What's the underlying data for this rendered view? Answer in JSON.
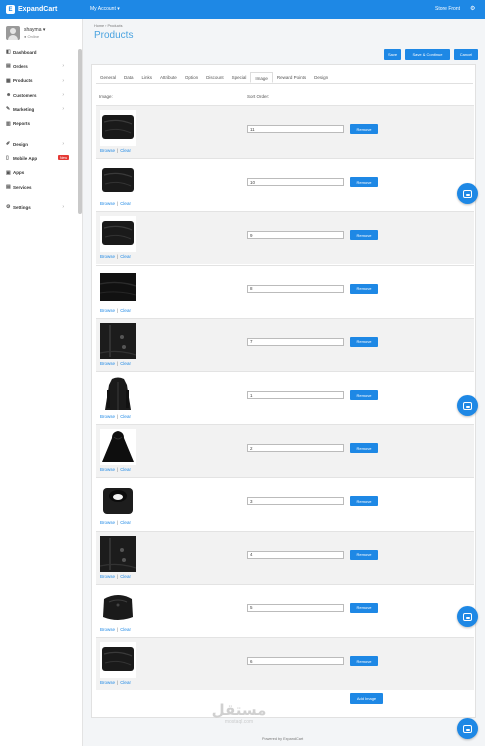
{
  "topbar": {
    "logo_text": "ExpandCart",
    "my_account": "My Account",
    "store_front": "Store Front",
    "settings_glyph": "⚙"
  },
  "user": {
    "name": "shayma",
    "status": "● Online"
  },
  "sidebar": {
    "items": [
      {
        "label": "Dashboard",
        "icon": "dashboard-icon",
        "glyph": "◧",
        "chevron": ""
      },
      {
        "label": "Orders",
        "icon": "orders-icon",
        "glyph": "▤",
        "chevron": "›"
      },
      {
        "label": "Products",
        "icon": "products-icon",
        "glyph": "▦",
        "chevron": "›"
      },
      {
        "label": "Customers",
        "icon": "customers-icon",
        "glyph": "☻",
        "chevron": "›"
      },
      {
        "label": "Marketing",
        "icon": "marketing-icon",
        "glyph": "✎",
        "chevron": "›"
      },
      {
        "label": "Reports",
        "icon": "reports-icon",
        "glyph": "▥",
        "chevron": ""
      },
      {
        "label": "Design",
        "icon": "design-icon",
        "glyph": "✐",
        "chevron": "›"
      },
      {
        "label": "Mobile App",
        "icon": "mobile-icon",
        "glyph": "▯",
        "chevron": "",
        "badge": "New"
      },
      {
        "label": "Apps",
        "icon": "apps-icon",
        "glyph": "▣",
        "chevron": ""
      },
      {
        "label": "Services",
        "icon": "services-icon",
        "glyph": "▤",
        "chevron": ""
      },
      {
        "label": "Settings",
        "icon": "settings-icon",
        "glyph": "⚙",
        "chevron": "›"
      }
    ]
  },
  "breadcrumb": "Home  ›  Products",
  "page_title": "Products",
  "actions": {
    "save": "Save",
    "save_continue": "Save & Continue",
    "cancel": "Cancel"
  },
  "tabs": [
    "General",
    "Data",
    "Links",
    "Attribute",
    "Option",
    "Discount",
    "Special",
    "Image",
    "Reward Points",
    "Design"
  ],
  "active_tab": "Image",
  "table": {
    "col_image": "Image:",
    "col_sort": "Sort Order:"
  },
  "row_labels": {
    "browse": "Browse",
    "clear": "Clear",
    "remove": "Remove"
  },
  "images": [
    {
      "sort": "11",
      "style": "folded"
    },
    {
      "sort": "10",
      "style": "folded"
    },
    {
      "sort": "9",
      "style": "folded"
    },
    {
      "sort": "8",
      "style": "fabric"
    },
    {
      "sort": "7",
      "style": "detail"
    },
    {
      "sort": "1",
      "style": "coat"
    },
    {
      "sort": "2",
      "style": "cape"
    },
    {
      "sort": "3",
      "style": "hood"
    },
    {
      "sort": "4",
      "style": "detail"
    },
    {
      "sort": "5",
      "style": "back"
    },
    {
      "sort": "6",
      "style": "folded"
    }
  ],
  "add_image": "Add Image",
  "watermark": {
    "main": "مستقل",
    "sub": "mostaql.com"
  },
  "footer": "Powered by ExpandCart",
  "colors": {
    "accent": "#1e88e5",
    "title": "#4aa3e0",
    "badge": "#e53935"
  }
}
